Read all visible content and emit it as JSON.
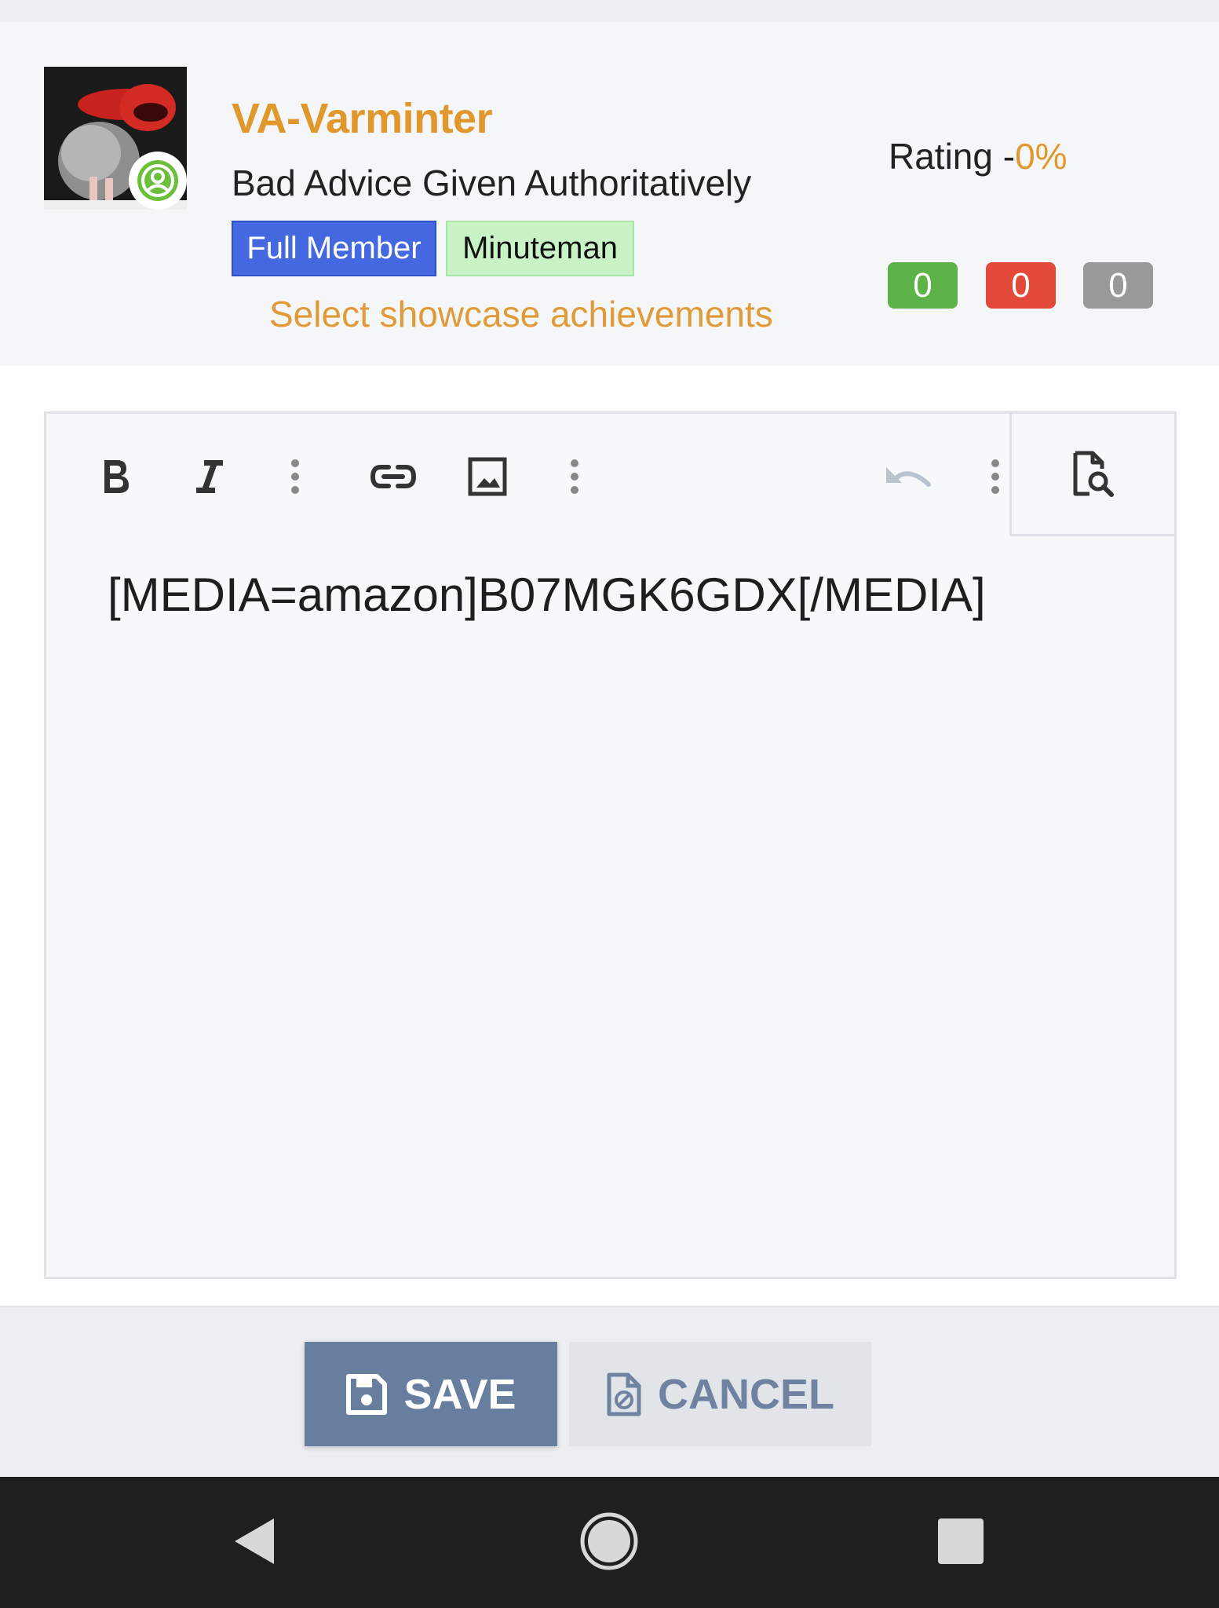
{
  "user": {
    "username": "VA-Varminter",
    "title": "Bad Advice Given Authoritatively",
    "badges": [
      "Full Member",
      "Minuteman"
    ],
    "showcase_link": "Select showcase achievements",
    "rating_label": "Rating -",
    "rating_value": "0%",
    "counters": {
      "positive": "0",
      "negative": "0",
      "neutral": "0"
    },
    "colors": {
      "username": "#e0982c",
      "badge_full_member": "#4468e0",
      "badge_minuteman": "#c9f3c7",
      "counter_positive": "#5db347",
      "counter_negative": "#e2493b",
      "counter_neutral": "#999999"
    }
  },
  "editor": {
    "toolbar": [
      "bold-icon",
      "italic-icon",
      "more-vertical-icon",
      "link-icon",
      "image-icon",
      "more-vertical-icon",
      "undo-icon",
      "more-vertical-icon",
      "preview-icon"
    ],
    "content": "[MEDIA=amazon]B07MGK6GDX[/MEDIA]"
  },
  "actions": {
    "save_label": "SAVE",
    "cancel_label": "CANCEL",
    "save_color": "#677e9f"
  },
  "navigation": [
    "back-icon",
    "home-icon",
    "recents-icon"
  ]
}
